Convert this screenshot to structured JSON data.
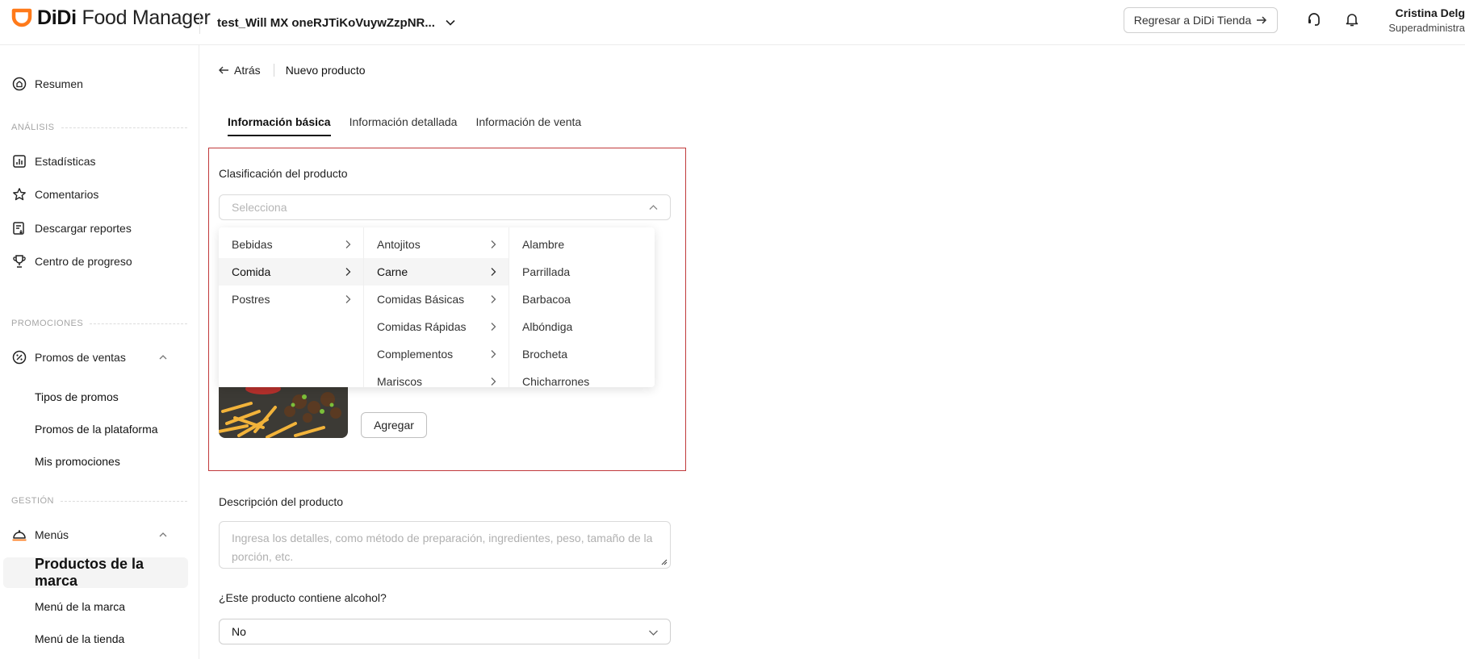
{
  "header": {
    "logo_brand": "DiDi",
    "logo_product": "Food Manager",
    "store_name": "test_Will MX oneRJTiKoVuywZzpNR...",
    "return_label": "Regresar a DiDi Tienda",
    "user_name": "Cristina Delg",
    "user_role": "Superadministra",
    "accent_color": "#ff7a1a"
  },
  "sidebar": {
    "resumen": "Resumen",
    "section_analisis": "ANÁLISIS",
    "estadisticas": "Estadísticas",
    "comentarios": "Comentarios",
    "descargar": "Descargar reportes",
    "progreso": "Centro de progreso",
    "section_promociones": "PROMOCIONES",
    "promos_ventas": "Promos de ventas",
    "tipos_promos": "Tipos de promos",
    "promos_plataforma": "Promos de la plataforma",
    "mis_promociones": "Mis promociones",
    "section_gestion": "GESTIÓN",
    "menus": "Menús",
    "productos_marca": "Productos de la marca",
    "menu_marca": "Menú de la marca",
    "menu_tienda": "Menú de la tienda"
  },
  "main": {
    "back_label": "Atrás",
    "page_title": "Nuevo producto",
    "tabs": [
      {
        "label": "Información básica"
      },
      {
        "label": "Información detallada"
      },
      {
        "label": "Información de venta"
      }
    ],
    "classification_label": "Clasificación del producto",
    "classification_placeholder": "Selecciona",
    "cascader": {
      "col1": [
        "Bebidas",
        "Comida",
        "Postres"
      ],
      "col2": [
        "Antojitos",
        "Carne",
        "Comidas Básicas",
        "Comidas Rápidas",
        "Complementos",
        "Mariscos"
      ],
      "col3": [
        "Alambre",
        "Parrillada",
        "Barbacoa",
        "Albóndiga",
        "Brocheta",
        "Chicharrones"
      ]
    },
    "add_button": "Agregar",
    "description_label": "Descripción del producto",
    "description_placeholder": "Ingresa los detalles, como método de preparación, ingredientes, peso, tamaño de la porción, etc.",
    "alcohol_label": "¿Este producto contiene alcohol?",
    "alcohol_value": "No"
  }
}
